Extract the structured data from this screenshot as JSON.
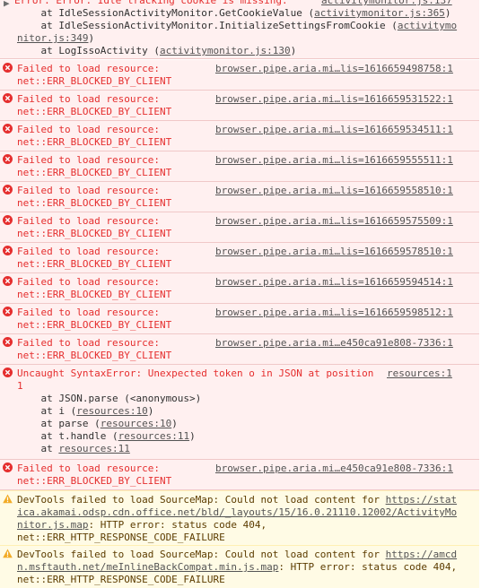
{
  "top_entry": {
    "message": "Error: Error: Idle tracking cookie is missing.",
    "source": "activitymonitor.js:137",
    "stack": [
      {
        "prefix": "    at IdleSessionActivityMonitor.GetCookieValue (",
        "link": "activitymonitor.js:365",
        "suffix": ")"
      },
      {
        "prefix": "    at IdleSessionActivityMonitor.InitializeSettingsFromCookie (",
        "link": "activitymo",
        "suffix": ""
      },
      {
        "prefix": "",
        "link": "nitor.js:349",
        "suffix": ")"
      },
      {
        "prefix": "    at LogIssoActivity (",
        "link": "activitymonitor.js:130",
        "suffix": ")"
      }
    ]
  },
  "failed_entries": [
    {
      "line1": "Failed to load resource:",
      "line2": "net::ERR_BLOCKED_BY_CLIENT",
      "source": "browser.pipe.aria.mi…lis=1616659498758:1"
    },
    {
      "line1": "Failed to load resource:",
      "line2": "net::ERR_BLOCKED_BY_CLIENT",
      "source": "browser.pipe.aria.mi…lis=1616659531522:1"
    },
    {
      "line1": "Failed to load resource:",
      "line2": "net::ERR_BLOCKED_BY_CLIENT",
      "source": "browser.pipe.aria.mi…lis=1616659534511:1"
    },
    {
      "line1": "Failed to load resource:",
      "line2": "net::ERR_BLOCKED_BY_CLIENT",
      "source": "browser.pipe.aria.mi…lis=1616659555511:1"
    },
    {
      "line1": "Failed to load resource:",
      "line2": "net::ERR_BLOCKED_BY_CLIENT",
      "source": "browser.pipe.aria.mi…lis=1616659558510:1"
    },
    {
      "line1": "Failed to load resource:",
      "line2": "net::ERR_BLOCKED_BY_CLIENT",
      "source": "browser.pipe.aria.mi…lis=1616659575509:1"
    },
    {
      "line1": "Failed to load resource:",
      "line2": "net::ERR_BLOCKED_BY_CLIENT",
      "source": "browser.pipe.aria.mi…lis=1616659578510:1"
    },
    {
      "line1": "Failed to load resource:",
      "line2": "net::ERR_BLOCKED_BY_CLIENT",
      "source": "browser.pipe.aria.mi…lis=1616659594514:1"
    },
    {
      "line1": "Failed to load resource:",
      "line2": "net::ERR_BLOCKED_BY_CLIENT",
      "source": "browser.pipe.aria.mi…lis=1616659598512:1"
    },
    {
      "line1": "Failed to load resource:",
      "line2": "net::ERR_BLOCKED_BY_CLIENT",
      "source": "browser.pipe.aria.mi…e450ca91e808-7336:1"
    }
  ],
  "syntax_error": {
    "message": "Uncaught SyntaxError: Unexpected token o in JSON at position",
    "cont": "1",
    "source": "resources:1",
    "stack": [
      {
        "prefix": "    at JSON.parse (<anonymous>)",
        "link": "",
        "suffix": ""
      },
      {
        "prefix": "    at i (",
        "link": "resources:10",
        "suffix": ")"
      },
      {
        "prefix": "    at parse (",
        "link": "resources:10",
        "suffix": ")"
      },
      {
        "prefix": "    at t.handle (",
        "link": "resources:11",
        "suffix": ")"
      },
      {
        "prefix": "    at ",
        "link": "resources:11",
        "suffix": ""
      }
    ]
  },
  "last_failed": {
    "line1": "Failed to load resource:",
    "line2": "net::ERR_BLOCKED_BY_CLIENT",
    "source": "browser.pipe.aria.mi…e450ca91e808-7336:1"
  },
  "warnings": [
    {
      "lines": [
        {
          "prefix": "DevTools failed to load SourceMap: Could not load content for ",
          "link": "https://stat",
          "suffix": ""
        },
        {
          "prefix": "",
          "link": "ica.akamai.odsp.cdn.office.net/bld/_layouts/15/16.0.21110.12002/ActivityMo",
          "suffix": ""
        },
        {
          "prefix": "",
          "link": "nitor.js.map",
          "suffix": ": HTTP error: status code 404,"
        },
        {
          "prefix": "net::ERR_HTTP_RESPONSE_CODE_FAILURE",
          "link": "",
          "suffix": ""
        }
      ]
    },
    {
      "lines": [
        {
          "prefix": "DevTools failed to load SourceMap: Could not load content for ",
          "link": "https://amcd",
          "suffix": ""
        },
        {
          "prefix": "",
          "link": "n.msftauth.net/meInlineBackCompat.min.js.map",
          "suffix": ": HTTP error: status code 404,"
        },
        {
          "prefix": "net::ERR_HTTP_RESPONSE_CODE_FAILURE",
          "link": "",
          "suffix": ""
        }
      ]
    }
  ],
  "colors": {
    "error_text": "#e52e2e",
    "error_bg": "#fff0f0",
    "warning_bg": "#fffbe5",
    "warning_text": "#5c3c00"
  }
}
